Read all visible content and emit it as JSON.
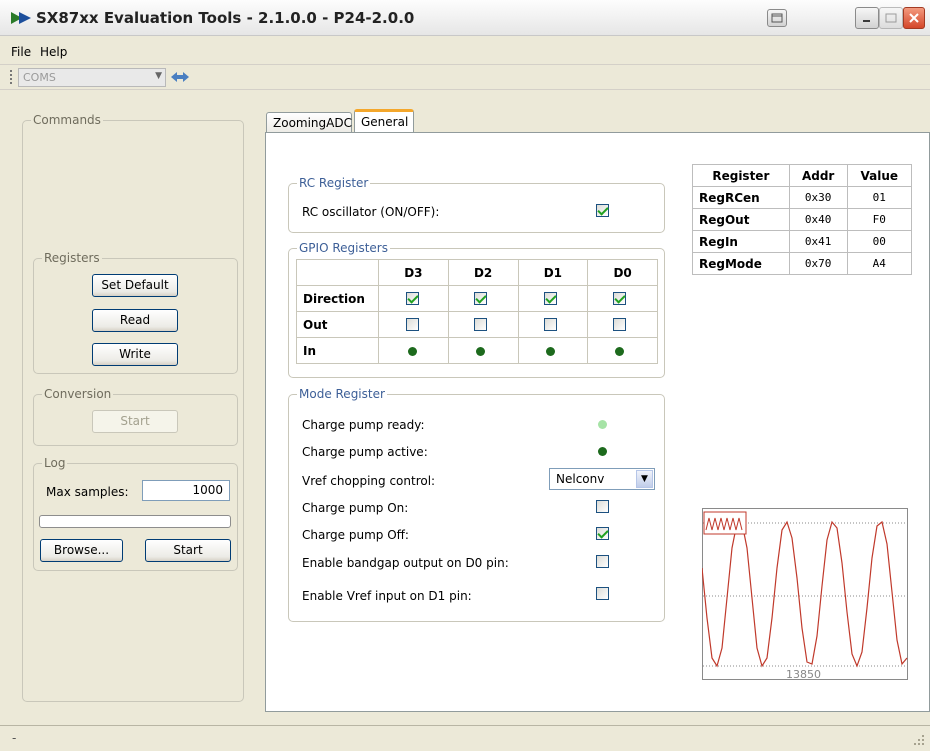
{
  "window": {
    "title": "SX87xx Evaluation Tools - 2.1.0.0 - P24-2.0.0"
  },
  "menu": {
    "file": "File",
    "help": "Help"
  },
  "toolbar": {
    "coms_value": "COMS"
  },
  "left": {
    "commands_legend": "Commands",
    "registers_legend": "Registers",
    "set_default": "Set Default",
    "read": "Read",
    "write": "Write",
    "conversion_legend": "Conversion",
    "conversion_start": "Start",
    "log_legend": "Log",
    "max_samples_label": "Max samples:",
    "max_samples_value": "1000",
    "log_progress": 0,
    "browse": "Browse...",
    "log_start": "Start"
  },
  "tabs": [
    {
      "label": "ZoomingADC"
    },
    {
      "label": "General"
    }
  ],
  "rc_register": {
    "legend": "RC Register",
    "oscillator_label": "RC oscillator (ON/OFF):",
    "oscillator_checked": true
  },
  "gpio": {
    "legend": "GPIO Registers",
    "columns": [
      "D3",
      "D2",
      "D1",
      "D0"
    ],
    "rows": [
      {
        "label": "Direction",
        "type": "checkbox",
        "values": [
          true,
          true,
          true,
          true
        ]
      },
      {
        "label": "Out",
        "type": "checkbox",
        "values": [
          false,
          false,
          false,
          false
        ]
      },
      {
        "label": "In",
        "type": "led",
        "values": [
          true,
          true,
          true,
          true
        ]
      }
    ]
  },
  "mode_register": {
    "legend": "Mode Register",
    "pump_ready_label": "Charge pump ready:",
    "pump_ready_on": false,
    "pump_active_label": "Charge pump active:",
    "pump_active_on": true,
    "vref_label": "Vref chopping control:",
    "vref_value": "Nelconv",
    "pump_on_label": "Charge pump On:",
    "pump_on_checked": false,
    "pump_off_label": "Charge pump Off:",
    "pump_off_checked": true,
    "bandgap_label": "Enable bandgap output on D0 pin:",
    "bandgap_checked": false,
    "vref_input_label": "Enable Vref input on D1 pin:",
    "vref_input_checked": false
  },
  "register_table": {
    "headers": [
      "Register",
      "Addr",
      "Value"
    ],
    "rows": [
      {
        "name": "RegRCen",
        "addr": "0x30",
        "value": "01"
      },
      {
        "name": "RegOut",
        "addr": "0x40",
        "value": "F0"
      },
      {
        "name": "RegIn",
        "addr": "0x41",
        "value": "00"
      },
      {
        "name": "RegMode",
        "addr": "0x70",
        "value": "A4"
      }
    ]
  },
  "scope": {
    "value_label": "13850"
  },
  "statusbar": {
    "text": "-"
  }
}
